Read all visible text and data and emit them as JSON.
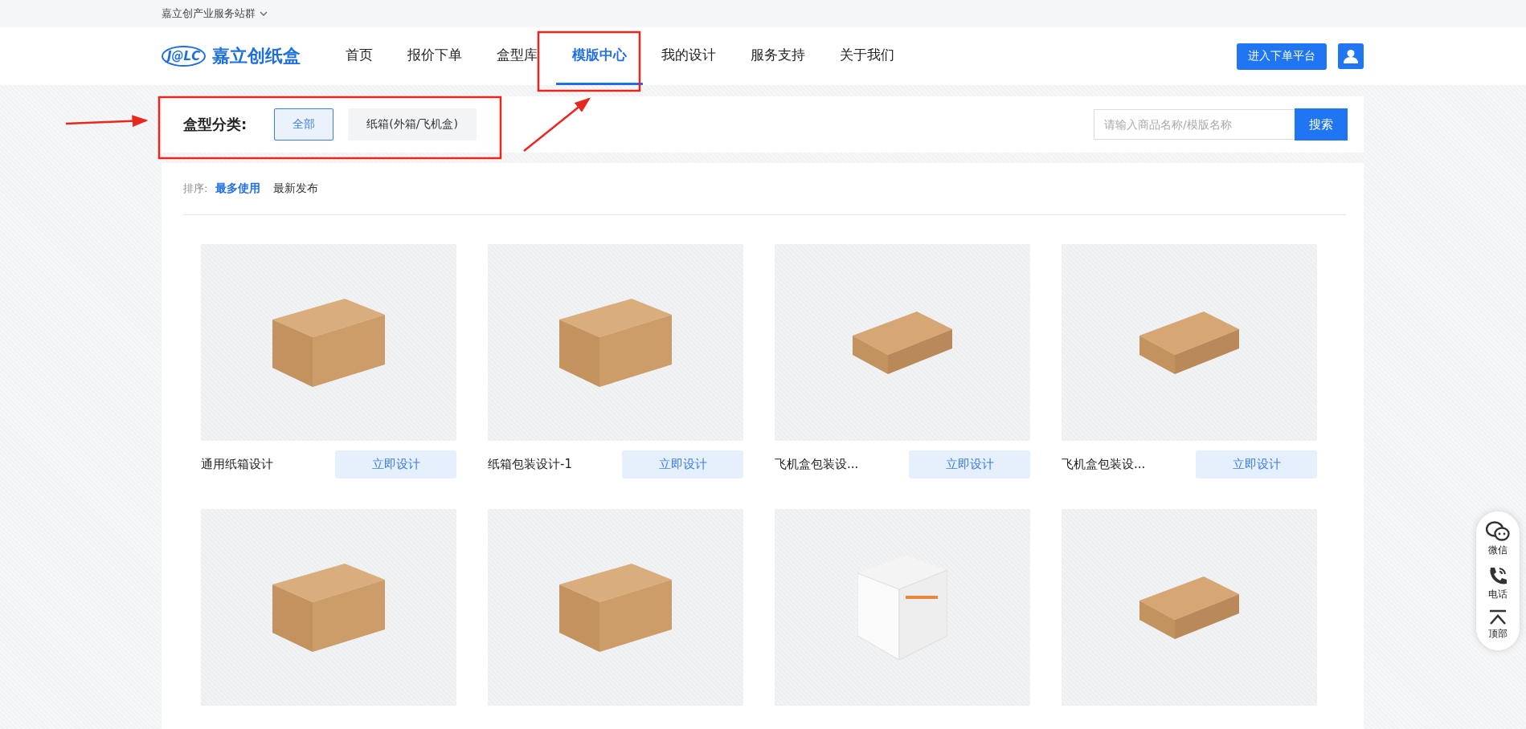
{
  "top_bar": {
    "site_group": "嘉立创产业服务站群"
  },
  "header": {
    "logo_mark": "J@LC",
    "logo_text": "嘉立创纸盒",
    "nav": [
      {
        "label": "首页",
        "selected": false
      },
      {
        "label": "报价下单",
        "selected": false
      },
      {
        "label": "盒型库",
        "selected": false
      },
      {
        "label": "模版中心",
        "selected": true
      },
      {
        "label": "我的设计",
        "selected": false
      },
      {
        "label": "服务支持",
        "selected": false
      },
      {
        "label": "关于我们",
        "selected": false
      }
    ],
    "order_button": "进入下单平台"
  },
  "filter": {
    "label": "盒型分类:",
    "options": [
      {
        "label": "全部",
        "selected": true
      },
      {
        "label": "纸箱(外箱/飞机盒)",
        "selected": false
      }
    ],
    "search": {
      "placeholder": "请输入商品名称/模版名称",
      "button": "搜索"
    }
  },
  "sort": {
    "label": "排序:",
    "options": [
      {
        "label": "最多使用",
        "selected": true
      },
      {
        "label": "最新发布",
        "selected": false
      }
    ]
  },
  "cards": [
    {
      "kind": "carton",
      "title": "通用纸箱设计",
      "button": "立即设计"
    },
    {
      "kind": "carton",
      "title": "纸箱包装设计-1",
      "button": "立即设计"
    },
    {
      "kind": "mailer",
      "title": "飞机盒包装设...",
      "button": "立即设计"
    },
    {
      "kind": "mailer",
      "title": "飞机盒包装设...",
      "button": "立即设计"
    },
    {
      "kind": "carton"
    },
    {
      "kind": "carton"
    },
    {
      "kind": "cube"
    },
    {
      "kind": "mailer"
    }
  ],
  "side_tools": [
    {
      "kind": "wechat",
      "label": "微信"
    },
    {
      "kind": "phone",
      "label": "电话"
    },
    {
      "kind": "top",
      "label": "顶部"
    }
  ]
}
